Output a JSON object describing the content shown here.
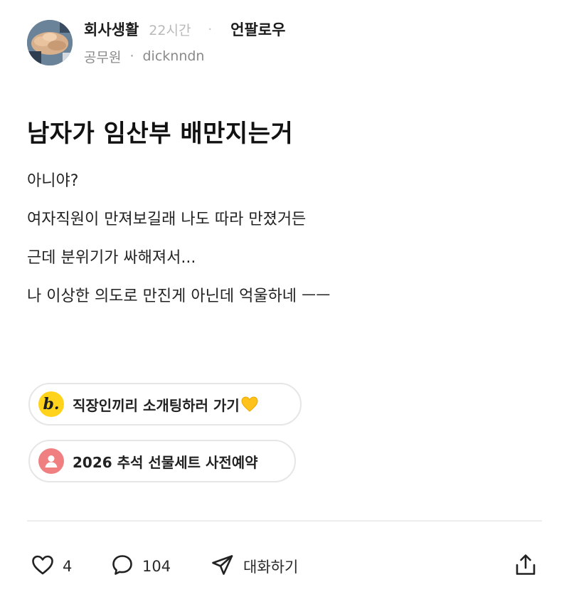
{
  "post": {
    "community": "회사생활",
    "time_ago": "22시간",
    "follow_label": "언팔로우",
    "author_job": "공무원",
    "author_name": "dicknndn",
    "title": "남자가 임산부 배만지는거",
    "body_lines": [
      "아니야?",
      "여자직원이 만져보길래 나도 따라 만졌거든",
      "근데 분위기가 싸해져서...",
      "나 이상한 의도로 만진게 아닌데 억울하네 ㅡㅡ"
    ]
  },
  "chips": [
    {
      "icon": "blind-b-icon",
      "icon_letter": "b.",
      "label": "직장인끼리 소개팅하러 가기",
      "icon_color": "#ffd21c"
    },
    {
      "icon": "person-icon",
      "label": "2026 추석 선물세트 사전예약",
      "icon_color": "#ef7f80"
    }
  ],
  "actions": {
    "like_count": "4",
    "comment_count": "104",
    "chat_label": "대화하기"
  },
  "icons": [
    "heart-icon",
    "comment-icon",
    "send-icon",
    "share-icon",
    "yellow-heart-icon"
  ]
}
